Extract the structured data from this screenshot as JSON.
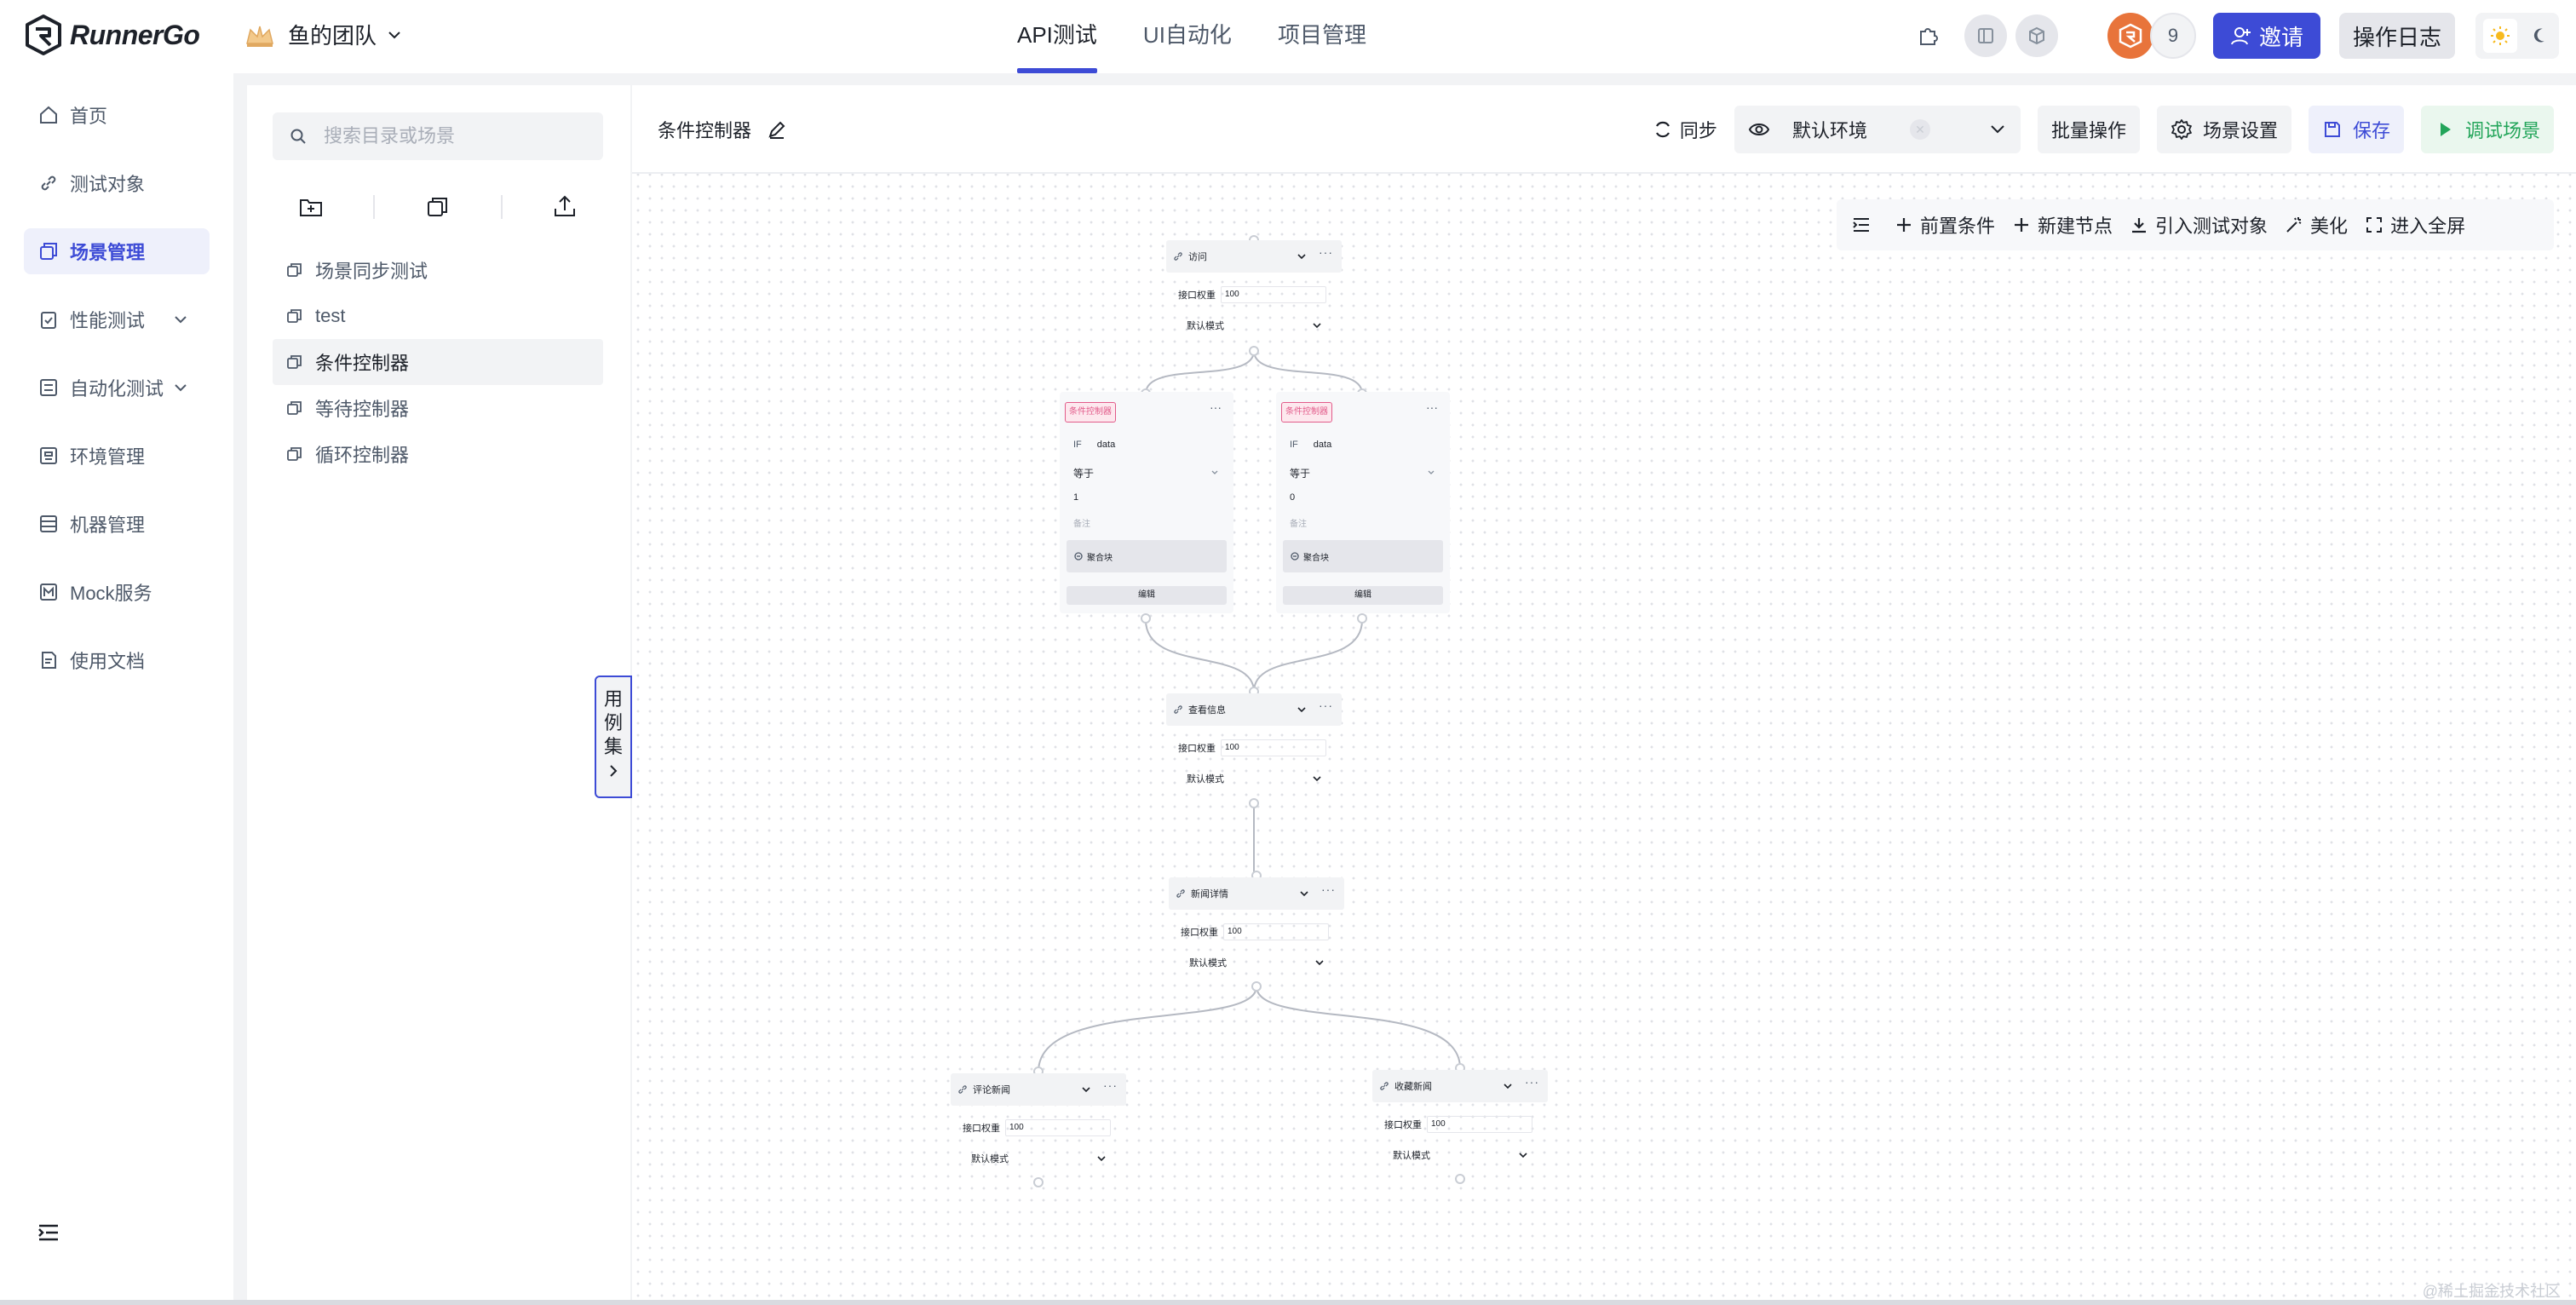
{
  "app": {
    "logo_text": "RunnerGo"
  },
  "team": {
    "name": "鱼的团队"
  },
  "top_tabs": [
    {
      "label": "API测试",
      "active": true
    },
    {
      "label": "UI自动化",
      "active": false
    },
    {
      "label": "项目管理",
      "active": false
    }
  ],
  "top_right": {
    "member_count": "9",
    "invite_label": "邀请",
    "log_label": "操作日志"
  },
  "sidebar": {
    "items": [
      {
        "label": "首页",
        "icon": "home-icon"
      },
      {
        "label": "测试对象",
        "icon": "link-icon"
      },
      {
        "label": "场景管理",
        "icon": "scene-icon",
        "active": true
      },
      {
        "label": "性能测试",
        "icon": "clipboard-icon",
        "expandable": true
      },
      {
        "label": "自动化测试",
        "icon": "checklist-icon",
        "expandable": true
      },
      {
        "label": "环境管理",
        "icon": "env-icon"
      },
      {
        "label": "机器管理",
        "icon": "server-icon"
      },
      {
        "label": "Mock服务",
        "icon": "mock-icon"
      },
      {
        "label": "使用文档",
        "icon": "doc-icon"
      }
    ]
  },
  "directory": {
    "search_placeholder": "搜索目录或场景",
    "items": [
      {
        "label": "场景同步测试",
        "active": false
      },
      {
        "label": "test",
        "active": false
      },
      {
        "label": "条件控制器",
        "active": true
      },
      {
        "label": "等待控制器",
        "active": false
      },
      {
        "label": "循环控制器",
        "active": false
      }
    ],
    "case_tab_chars": [
      "用",
      "例",
      "集"
    ]
  },
  "scene_header": {
    "title": "条件控制器",
    "sync_label": "同步",
    "env_label": "默认环境",
    "batch_label": "批量操作",
    "settings_label": "场景设置",
    "save_label": "保存",
    "debug_label": "调试场景"
  },
  "canvas_tools": {
    "pre_condition": "前置条件",
    "new_node": "新建节点",
    "import_object": "引入测试对象",
    "beautify": "美化",
    "fullscreen": "进入全屏"
  },
  "flow": {
    "api_weight_label": "接口权重",
    "api_mode_label": "默认模式",
    "api_nodes": [
      {
        "name": "访问",
        "weight": "100"
      },
      {
        "name": "查看信息",
        "weight": "100"
      },
      {
        "name": "新闻详情",
        "weight": "100"
      },
      {
        "name": "评论新闻",
        "weight": "100"
      },
      {
        "name": "收藏新闻",
        "weight": "100"
      }
    ],
    "cond_tag": "条件控制器",
    "cond_if": "IF",
    "cond_note_placeholder": "备注",
    "cond_block_label": "聚合块",
    "cond_edit_label": "编辑",
    "cond_nodes": [
      {
        "var": "data",
        "op": "等于",
        "value": "1"
      },
      {
        "var": "data",
        "op": "等于",
        "value": "0"
      }
    ]
  },
  "watermark": "@稀土掘金技术社区",
  "colors": {
    "accent": "#3d4bd6",
    "debug_green": "#23a55a",
    "cond_pink": "#e25b8a",
    "avatar_orange": "#e8743b"
  }
}
